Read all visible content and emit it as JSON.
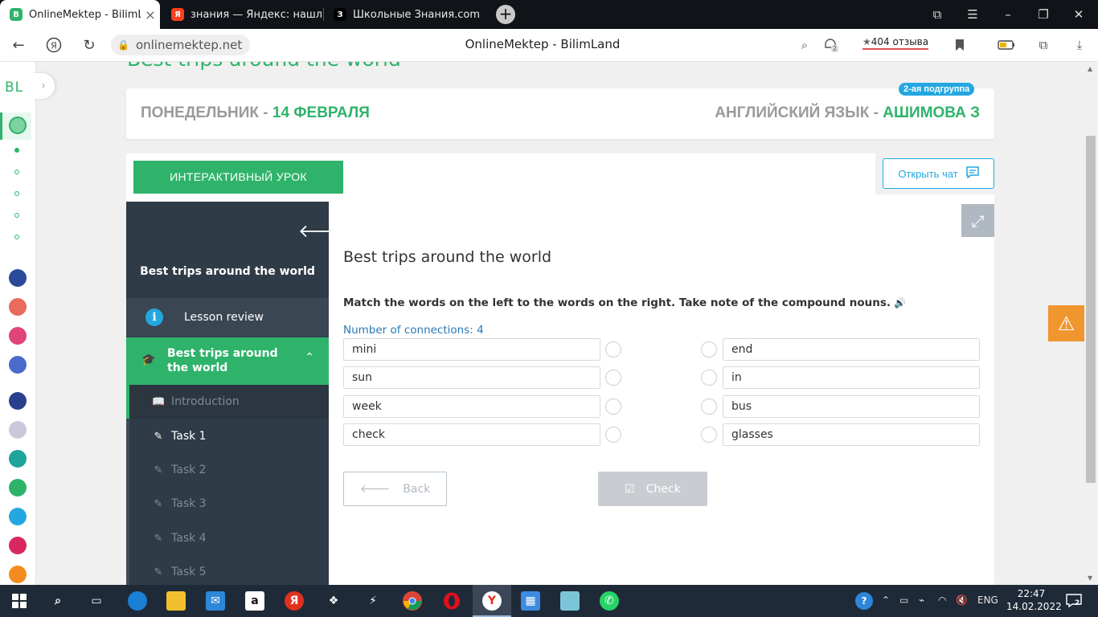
{
  "browser": {
    "tabs": [
      {
        "title": "OnlineMektep - BilimLand",
        "favicon": "B",
        "active": true
      },
      {
        "title": "знания — Яндекс: нашлось",
        "favicon": "Я",
        "active": false
      },
      {
        "title": "Школьные Знания.com - Р",
        "favicon": "З",
        "active": false
      }
    ],
    "url": "onlinemektep.net",
    "page_title": "OnlineMektep - BilimLand",
    "reviews_label": "404 отзыва",
    "badge_count": "2"
  },
  "site": {
    "logo": "BL",
    "page_heading": "Best trips around the world",
    "date_label": "ПОНЕДЕЛЬНИК - ",
    "date_value": "14 ФЕВРАЛЯ",
    "subject_label": "АНГЛИЙСКИЙ ЯЗЫК - ",
    "teacher": "АШИМОВА З",
    "subgroup": "2-ая подгруппа",
    "interactive_label": "ИНТЕРАКТИВНЫЙ УРОК",
    "chat_label": "Открыть чат"
  },
  "lesson_nav": {
    "title": "Best trips around the world",
    "review_label": "Lesson review",
    "section_label": "Best trips around the world",
    "items": [
      {
        "label": "Introduction"
      },
      {
        "label": "Task 1"
      },
      {
        "label": "Task 2"
      },
      {
        "label": "Task 3"
      },
      {
        "label": "Task 4"
      },
      {
        "label": "Task 5"
      }
    ]
  },
  "task": {
    "title": "Best trips around the world",
    "instruction": "Match the words on the left to the words on the right. Take note of the compound nouns.",
    "connections": "Number of connections: 4",
    "left_words": [
      "mini",
      "sun",
      "week",
      "check"
    ],
    "right_words": [
      "end",
      "in",
      "bus",
      "glasses"
    ],
    "back_label": "Back",
    "check_label": "Check"
  },
  "taskbar": {
    "time": "22:47",
    "date": "14.02.2022",
    "lang": "ENG",
    "notification_count": "2"
  },
  "colors": {
    "brand_green": "#2fb36b",
    "accent_blue": "#24a7e0",
    "nav_dark": "#2f3b47",
    "warning": "#f0962e"
  }
}
